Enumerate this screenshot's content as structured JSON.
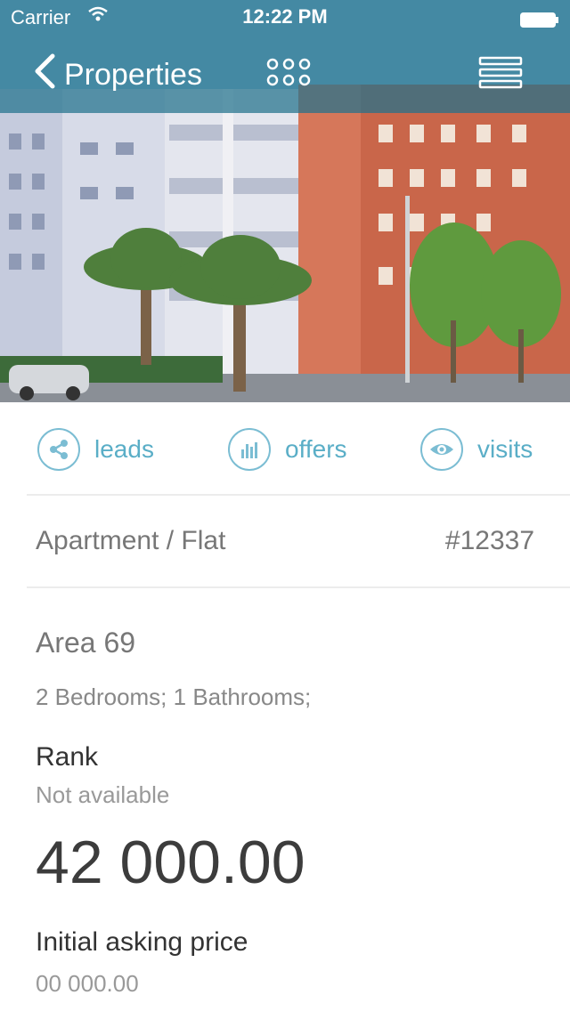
{
  "status_bar": {
    "carrier": "Carrier",
    "time": "12:22 PM"
  },
  "nav": {
    "back_label": "Properties",
    "back_icon": "chevron-left-icon",
    "grid_icon": "grid-dots-icon",
    "menu_icon": "hamburger-menu-icon"
  },
  "actions": [
    {
      "label": "leads",
      "icon": "share-icon"
    },
    {
      "label": "offers",
      "icon": "bar-chart-icon"
    },
    {
      "label": "visits",
      "icon": "eye-icon"
    }
  ],
  "property": {
    "type": "Apartment / Flat",
    "reference": "#12337",
    "area": "Area 69",
    "rooms": "2 Bedrooms; 1 Bathrooms;",
    "rank_label": "Rank",
    "rank_value": "Not available",
    "price": "42 000.00",
    "asking_label": "Initial asking price",
    "asking_value": "00 000.00"
  },
  "colors": {
    "accent": "#5aaec7",
    "navbar": "#21718c",
    "text_dark": "#333333",
    "text_muted": "#999999"
  }
}
